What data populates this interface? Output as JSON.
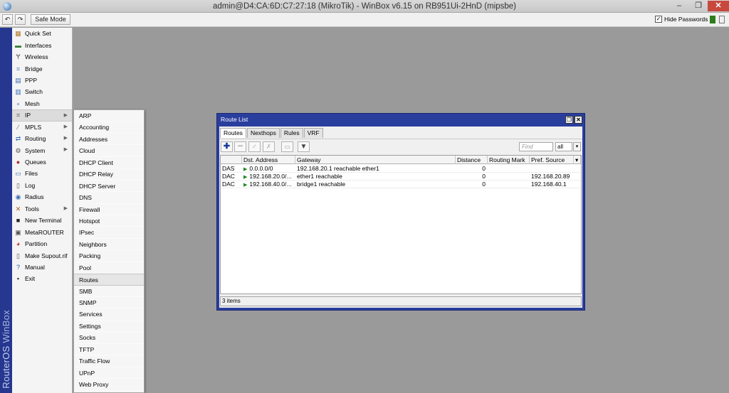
{
  "window": {
    "title": "admin@D4:CA:6D:C7:27:18 (MikroTik) - WinBox v6.15 on RB951Ui-2HnD (mipsbe)",
    "min_glyph": "‒",
    "max_glyph": "❐",
    "close_glyph": "✕"
  },
  "toolbar": {
    "undo_glyph": "↶",
    "redo_glyph": "↷",
    "safe_mode_label": "Safe Mode",
    "hide_passwords_label": "Hide Passwords",
    "hide_passwords_checked": true,
    "check_glyph": "✓"
  },
  "brand": {
    "part1": "RouterOS",
    "part2": " WinBox"
  },
  "menu": {
    "items": [
      {
        "label": "Quick Set",
        "icon": "quick-set-icon",
        "glyph": "▦",
        "color": "#b07a2a"
      },
      {
        "label": "Interfaces",
        "icon": "interfaces-icon",
        "glyph": "▬",
        "color": "#2f7d2f"
      },
      {
        "label": "Wireless",
        "icon": "wireless-icon",
        "glyph": "Ɏ",
        "color": "#555555"
      },
      {
        "label": "Bridge",
        "icon": "bridge-icon",
        "glyph": "⌗",
        "color": "#3a6db5"
      },
      {
        "label": "PPP",
        "icon": "ppp-icon",
        "glyph": "▤",
        "color": "#3a6db5"
      },
      {
        "label": "Switch",
        "icon": "switch-icon",
        "glyph": "▥",
        "color": "#3a6db5"
      },
      {
        "label": "Mesh",
        "icon": "mesh-icon",
        "glyph": "∘",
        "color": "#3a6db5"
      },
      {
        "label": "IP",
        "icon": "ip-icon",
        "glyph": "⌗",
        "color": "#555555",
        "submenu": true,
        "active": true
      },
      {
        "label": "MPLS",
        "icon": "mpls-icon",
        "glyph": "⁄",
        "color": "#666666",
        "submenu": true
      },
      {
        "label": "Routing",
        "icon": "routing-icon",
        "glyph": "⇄",
        "color": "#3a6db5",
        "submenu": true
      },
      {
        "label": "System",
        "icon": "system-icon",
        "glyph": "⚙",
        "color": "#555555",
        "submenu": true
      },
      {
        "label": "Queues",
        "icon": "queues-icon",
        "glyph": "●",
        "color": "#b03030"
      },
      {
        "label": "Files",
        "icon": "files-icon",
        "glyph": "▭",
        "color": "#3a6db5"
      },
      {
        "label": "Log",
        "icon": "log-icon",
        "glyph": "▯",
        "color": "#555555"
      },
      {
        "label": "Radius",
        "icon": "radius-icon",
        "glyph": "◉",
        "color": "#3a6db5"
      },
      {
        "label": "Tools",
        "icon": "tools-icon",
        "glyph": "✕",
        "color": "#a05a20",
        "submenu": true
      },
      {
        "label": "New Terminal",
        "icon": "terminal-icon",
        "glyph": "■",
        "color": "#222222"
      },
      {
        "label": "MetaROUTER",
        "icon": "metarouter-icon",
        "glyph": "▣",
        "color": "#555555"
      },
      {
        "label": "Partition",
        "icon": "partition-icon",
        "glyph": "◕",
        "color": "#c0392b"
      },
      {
        "label": "Make Supout.rif",
        "icon": "supout-icon",
        "glyph": "▯",
        "color": "#555555"
      },
      {
        "label": "Manual",
        "icon": "manual-icon",
        "glyph": "?",
        "color": "#2a5db0"
      },
      {
        "label": "Exit",
        "icon": "exit-icon",
        "glyph": "▪",
        "color": "#333333"
      }
    ]
  },
  "submenu": {
    "items": [
      {
        "label": "ARP"
      },
      {
        "label": "Accounting"
      },
      {
        "label": "Addresses"
      },
      {
        "label": "Cloud"
      },
      {
        "label": "DHCP Client"
      },
      {
        "label": "DHCP Relay"
      },
      {
        "label": "DHCP Server"
      },
      {
        "label": "DNS"
      },
      {
        "label": "Firewall"
      },
      {
        "label": "Hotspot"
      },
      {
        "label": "IPsec"
      },
      {
        "label": "Neighbors"
      },
      {
        "label": "Packing"
      },
      {
        "label": "Pool"
      },
      {
        "label": "Routes",
        "active": true
      },
      {
        "label": "SMB"
      },
      {
        "label": "SNMP"
      },
      {
        "label": "Services"
      },
      {
        "label": "Settings"
      },
      {
        "label": "Socks"
      },
      {
        "label": "TFTP"
      },
      {
        "label": "Traffic Flow"
      },
      {
        "label": "UPnP"
      },
      {
        "label": "Web Proxy"
      }
    ]
  },
  "route_list": {
    "title": "Route List",
    "restore_glyph": "❐",
    "close_glyph": "✕",
    "tabs": [
      {
        "label": "Routes",
        "active": true
      },
      {
        "label": "Nexthops"
      },
      {
        "label": "Rules"
      },
      {
        "label": "VRF"
      }
    ],
    "tool_glyphs": {
      "add": "✚",
      "remove": "━",
      "enable": "✓",
      "disable": "✗",
      "comment": "▭",
      "filter": "▼"
    },
    "find_placeholder": "Find",
    "filter_value": "all",
    "dropdown_glyph": "▾",
    "columns": [
      {
        "label": ""
      },
      {
        "label": "Dst. Address"
      },
      {
        "label": "Gateway"
      },
      {
        "label": "Distance"
      },
      {
        "label": "Routing Mark"
      },
      {
        "label": "Pref. Source"
      },
      {
        "label": "▾"
      }
    ],
    "flag_glyph": "▶",
    "rows": [
      {
        "flags": "DAS",
        "dst": "0.0.0.0/0",
        "gateway": "192.168.20.1 reachable ether1",
        "distance": "0",
        "mark": "",
        "pref_source": ""
      },
      {
        "flags": "DAC",
        "dst": "192.168.20.0/...",
        "gateway": "ether1 reachable",
        "distance": "0",
        "mark": "",
        "pref_source": "192.168.20.89"
      },
      {
        "flags": "DAC",
        "dst": "192.168.40.0/...",
        "gateway": "bridge1 reachable",
        "distance": "0",
        "mark": "",
        "pref_source": "192.168.40.1"
      }
    ],
    "status": "3 items"
  }
}
